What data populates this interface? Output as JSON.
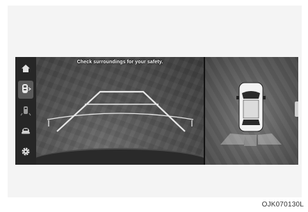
{
  "screen": {
    "warning_text": "Check surroundings for your safety.",
    "sidebar": [
      {
        "icon": "home-icon",
        "active": false
      },
      {
        "icon": "rear-view-camera-icon",
        "active": true
      },
      {
        "icon": "rear-side-view-icon",
        "active": false
      },
      {
        "icon": "top-view-icon",
        "active": false
      },
      {
        "icon": "gear-icon",
        "active": false
      }
    ],
    "colors": {
      "guide_white": "#e8e8e8",
      "sidebar_bg": "#262626",
      "active_bg": "#5a5a5a"
    }
  },
  "caption": "OJK070130L"
}
